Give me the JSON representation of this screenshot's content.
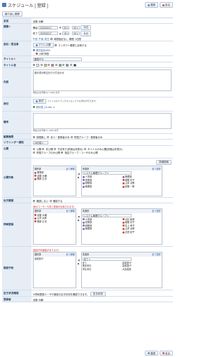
{
  "header": {
    "title": "スケジュール [ 登録 ]",
    "register_label": "登録",
    "back_label": "戻る"
  },
  "subbar": {
    "repeat_register_label": "繰り返し登録"
  },
  "fields": {
    "name": {
      "label": "名前",
      "value": "武藤 大輔"
    },
    "period": {
      "label": "期間",
      "start_prefix": "開始",
      "start_date": "2023/10/17",
      "start_hour": "09",
      "start_min": "00",
      "end_prefix": "終了",
      "end_date": "2023/10/17",
      "end_hour": "15",
      "end_min": "00",
      "today_label": "今日",
      "quick": [
        "午前",
        "午後",
        "終日",
        "時間指定なし",
        "期間",
        "1日間"
      ]
    },
    "company": {
      "label": "会社・担当者",
      "address_button": "アドレス帳",
      "contact_history": "コンタクト履歴に反映する",
      "company_name": "株式会社ABC",
      "person_name": "小林 伸吾"
    },
    "title": {
      "label": "タイトル",
      "value": "開発PTG"
    },
    "title_color": {
      "label": "タイトル色",
      "colors": [
        "#ffffff",
        "#f0c040",
        "#e07070",
        "#70b070",
        "#7090d0",
        "#333333"
      ]
    },
    "content": {
      "label": "内容",
      "value": "設計書の修正を行う打合わせ",
      "counter": "現在の文字数:12 / 1000 文字"
    },
    "attachment": {
      "label": "添付",
      "button": "添付",
      "hint": "ファイルのドラッグ＆ドロップでも添付が行えます。",
      "file": "設計書_01.xlsx"
    },
    "remarks": {
      "label": "備考",
      "counter": "現在の文字数:0 / 1000 文字"
    },
    "edit_permission": {
      "label": "編集権限",
      "options": [
        "制限無し",
        "本人・登録者のみ",
        "所属グループ・登録者のみ"
      ]
    },
    "reminder": {
      "label": "リマインダー通知",
      "value": "15分前"
    },
    "public": {
      "label": "公開",
      "options": [
        "公開",
        "非公開",
        "予定有り(詳細は非表示)",
        "タイトルのみ公開(詳細は非表示)",
        "所属グループのみ公開",
        "指定グループ・ユーザのみ公開"
      ],
      "detail_search": "詳細検索"
    },
    "public_target": {
      "label": "公開対象",
      "selected_header": "選択済",
      "selected_action": "全て解除",
      "selected": [
        "開発部",
        "武藤 大輔",
        "横原 正也"
      ],
      "candidate_header": "未選択",
      "candidate_action": "全て選択",
      "candidate_group": "システム管理グループ",
      "candidates": [
        "人事部",
        "営業部",
        "総務部",
        "管理部"
      ],
      "candidates2": [
        "管理部",
        "堀尾 花子",
        "山本 太郎",
        "佐藤 一郎",
        "小林 伸吾"
      ]
    },
    "attendance": {
      "label": "出欠確認",
      "options": [
        "確認しない",
        "確認する"
      ]
    },
    "participants": {
      "label": "同時登録",
      "note": "[他のユーザーも同じ登録が反映されます]",
      "selected_header": "選択済",
      "selected_action": "全て解除",
      "selected": [
        "武藤 大輔",
        "山本 太郎",
        "横原 正也"
      ],
      "candidate_header": "未選択",
      "candidate_action": "全て選択",
      "candidate_group": "システム管理グループ",
      "candidates": [
        "人事部",
        "営業部",
        "総務部",
        "管理部"
      ],
      "candidates2": [
        "大杉 和孝",
        "堀尾 花子",
        "井上 孝子",
        "山本 太郎",
        "吉田 紀子"
      ]
    },
    "facility": {
      "label": "施設予約",
      "note": "[施設予約機能があります]",
      "selected_header": "選択済",
      "selected_action": "全て解除",
      "selected": [
        "会議室1F"
      ],
      "candidate_header": "未選択",
      "candidate_action": "全て選択",
      "candidate_group": "全て",
      "candidates": [
        "全て",
        "東京本社",
        "本社本社"
      ],
      "candidates2": [
        "会議室1F",
        "会議室2F",
        "大会議室"
      ]
    },
    "free_time": {
      "label": "空き状況確認",
      "text": "※同時登録ユーザや施設の空き状況を確認できます。",
      "button": "空き状況"
    },
    "registrant": {
      "label": "登録者",
      "value": "武藤 大輔"
    }
  }
}
